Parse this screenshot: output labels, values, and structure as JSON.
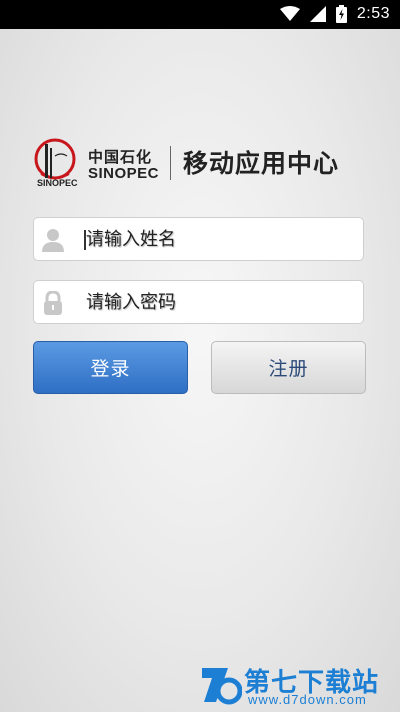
{
  "status_bar": {
    "time": "2:53"
  },
  "logo": {
    "brand_cn": "中国石化",
    "brand_en": "SINOPEC",
    "app_title": "移动应用中心"
  },
  "login_form": {
    "username_placeholder": "请输入姓名",
    "password_placeholder": "请输入密码",
    "login_label": "登录",
    "register_label": "注册"
  },
  "watermark": {
    "site_name": "第七下载站",
    "site_url": "www.d7down.com"
  },
  "colors": {
    "login_button": "#3b7fd1",
    "register_button": "#e3e3e3",
    "watermark": "#1c7fd4"
  }
}
